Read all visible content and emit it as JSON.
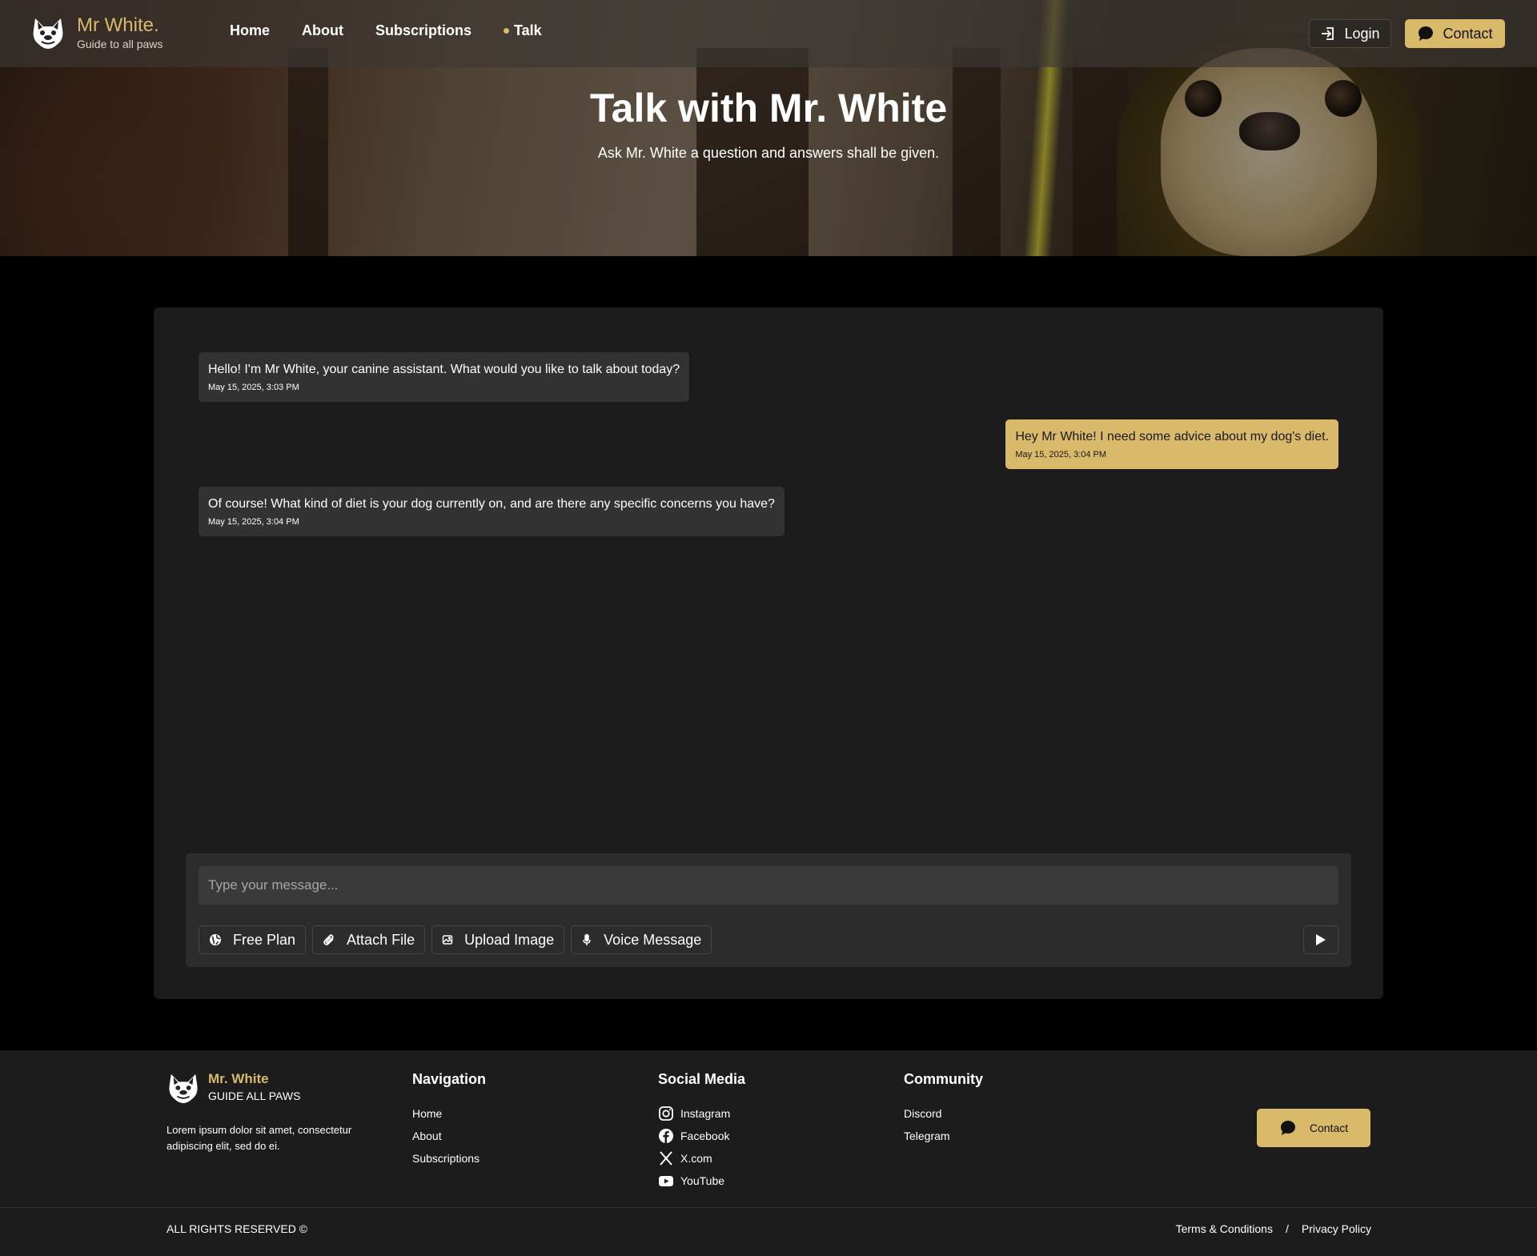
{
  "brand": {
    "title": "Mr White.",
    "subtitle": "Guide to all paws"
  },
  "nav": {
    "items": [
      {
        "label": "Home",
        "active": false
      },
      {
        "label": "About",
        "active": false
      },
      {
        "label": "Subscriptions",
        "active": false
      },
      {
        "label": "Talk",
        "active": true
      }
    ],
    "login_label": "Login",
    "contact_label": "Contact"
  },
  "hero": {
    "title": "Talk with Mr. White",
    "subtitle": "Ask Mr. White a question and answers shall be given."
  },
  "chat": {
    "messages": [
      {
        "sender": "bot",
        "text": "Hello! I'm Mr White, your canine assistant. What would you like to talk about today?",
        "time": "May 15, 2025, 3:03 PM"
      },
      {
        "sender": "user",
        "text": "Hey Mr White! I need some advice about my dog's diet.",
        "time": "May 15, 2025, 3:04 PM"
      },
      {
        "sender": "bot",
        "text": "Of course! What kind of diet is your dog currently on, and are there any specific concerns you have?",
        "time": "May 15, 2025, 3:04 PM"
      }
    ],
    "input_placeholder": "Type your message...",
    "tools": [
      {
        "label": "Free Plan",
        "icon": "globe-icon"
      },
      {
        "label": "Attach File",
        "icon": "paperclip-icon"
      },
      {
        "label": "Upload Image",
        "icon": "image-icon"
      },
      {
        "label": "Voice Message",
        "icon": "microphone-icon"
      }
    ],
    "send_icon": "play-icon"
  },
  "footer": {
    "brand_title": "Mr. White",
    "brand_sub": "GUIDE ALL PAWS",
    "description": "Lorem ipsum dolor sit amet, consectetur adipiscing elit, sed do ei.",
    "navigation": {
      "title": "Navigation",
      "links": [
        "Home",
        "About",
        "Subscriptions"
      ]
    },
    "social": {
      "title": "Social Media",
      "links": [
        {
          "label": "Instagram",
          "icon": "instagram-icon"
        },
        {
          "label": "Facebook",
          "icon": "facebook-icon"
        },
        {
          "label": "X.com",
          "icon": "x-icon"
        },
        {
          "label": "YouTube",
          "icon": "youtube-icon"
        }
      ]
    },
    "community": {
      "title": "Community",
      "links": [
        "Discord",
        "Telegram"
      ]
    },
    "contact_label": "Contact",
    "rights": "ALL RIGHTS RESERVED ©",
    "terms": "Terms & Conditions",
    "separator": "/",
    "privacy": "Privacy Policy"
  },
  "colors": {
    "accent": "#d9b96a",
    "panel": "#1b1b1b",
    "bubble_bot": "#333233",
    "composer": "#2c2c2c"
  }
}
